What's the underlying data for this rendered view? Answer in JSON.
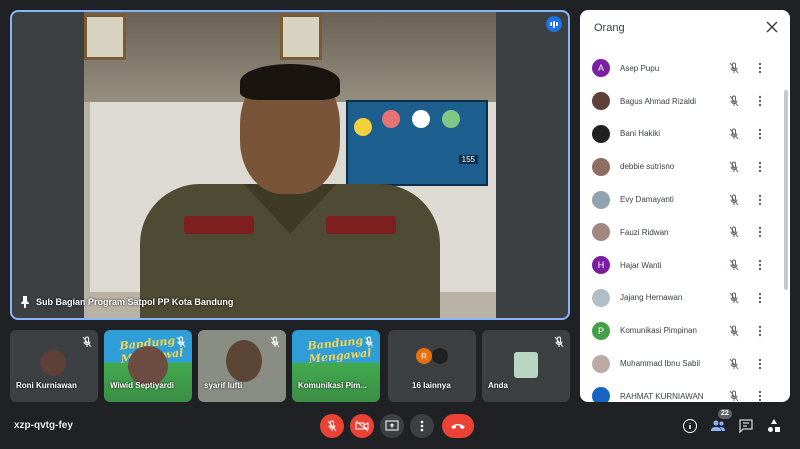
{
  "stage": {
    "speaker_label": "Sub Bagian Program Satpol PP Kota Bandung",
    "poster_number": "155"
  },
  "thumbnails": [
    {
      "name": "Roni Kurniawan",
      "muted": true
    },
    {
      "name": "Wiwid Septiyardi",
      "muted": true,
      "banner_text": "Bandung Mengawal"
    },
    {
      "name": "syarif lufti",
      "muted": true
    },
    {
      "name": "Komunikasi Pim...",
      "muted": true,
      "banner_text": "Bandung Mengawal"
    },
    {
      "name": "16 lainnya",
      "avatar_letter": "R"
    },
    {
      "name": "Anda",
      "muted": true
    }
  ],
  "people_panel": {
    "title": "Orang",
    "participants": [
      {
        "name": "Asep Pupu",
        "initial": "A",
        "color": "#7b1fa2"
      },
      {
        "name": "Bagus Ahmad Rizaldi",
        "color": "#5d4037"
      },
      {
        "name": "Bani Hakiki",
        "color": "#212121"
      },
      {
        "name": "debbie sutrisno",
        "color": "#8d6e63"
      },
      {
        "name": "Evy Damayanti",
        "color": "#90a4ae"
      },
      {
        "name": "Fauzi Ridwan",
        "color": "#a1887f"
      },
      {
        "name": "Hajar Wanti",
        "initial": "H",
        "color": "#7b1fa2"
      },
      {
        "name": "Jajang Hernawan",
        "color": "#b0bec5"
      },
      {
        "name": "Komunikasi Pimpinan",
        "initial": "P",
        "color": "#43a047"
      },
      {
        "name": "Muhammad Ibnu Sabil",
        "color": "#bcaaa4"
      },
      {
        "name": "RAHMAT KURNIAWAN",
        "color": "#1565c0"
      }
    ]
  },
  "bottom_bar": {
    "meeting_code": "xzp-qvtg-fey",
    "participant_count": "22"
  },
  "colors": {
    "end_call": "#ea4335",
    "accent": "#8ab4f8",
    "background": "#202124"
  }
}
